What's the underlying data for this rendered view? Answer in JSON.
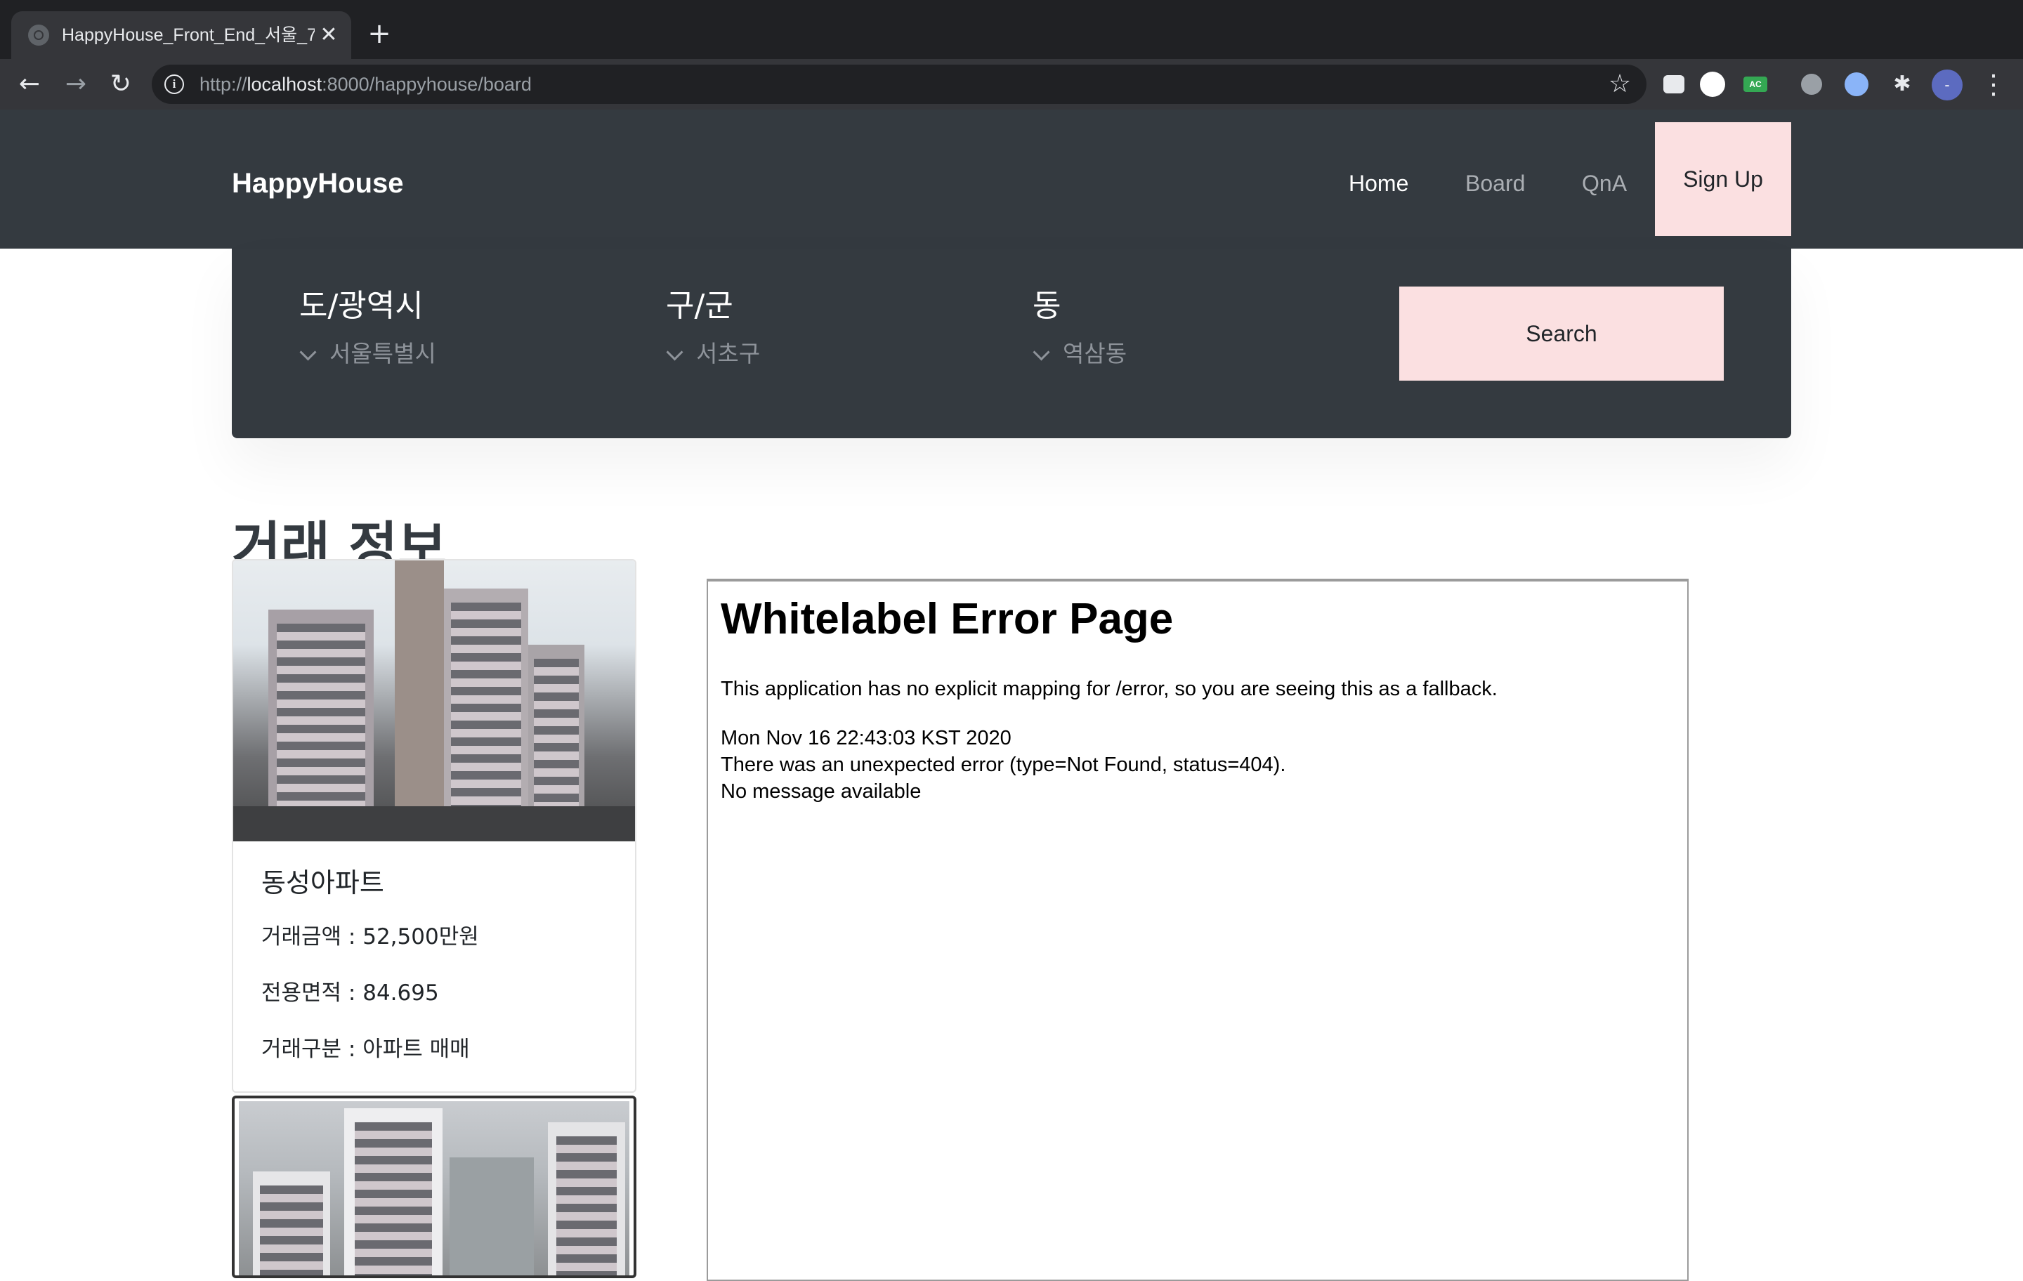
{
  "browser": {
    "tab_title": "HappyHouse_Front_End_서울_7",
    "tab_close": "✕",
    "new_tab": "+",
    "url_prefix": "http://",
    "url_host": "localhost",
    "url_path": ":8000/happyhouse/board",
    "ext_ac_label": "AC",
    "avatar_label": "-"
  },
  "site": {
    "brand": "HappyHouse",
    "nav": {
      "home": "Home",
      "board": "Board",
      "qna": "QnA",
      "signup": "Sign Up"
    },
    "colors": {
      "header_bg": "#343a40",
      "accent": "#fbe0e1"
    }
  },
  "search": {
    "sido_label": "도/광역시",
    "sido_value": "서울특별시",
    "gugun_label": "구/군",
    "gugun_value": "서초구",
    "dong_label": "동",
    "dong_value": "역삼동",
    "button": "Search"
  },
  "section_title": "거래 정보",
  "deals": [
    {
      "name": "동성아파트",
      "price": "거래금액 : 52,500만원",
      "area": "전용면적 : 84.695",
      "type": "거래구분 : 아파트 매매"
    }
  ],
  "error_page": {
    "title": "Whitelabel Error Page",
    "message": "This application has no explicit mapping for /error, so you are seeing this as a fallback.",
    "timestamp": "Mon Nov 16 22:43:03 KST 2020",
    "detail": "There was an unexpected error (type=Not Found, status=404).",
    "note": "No message available"
  }
}
